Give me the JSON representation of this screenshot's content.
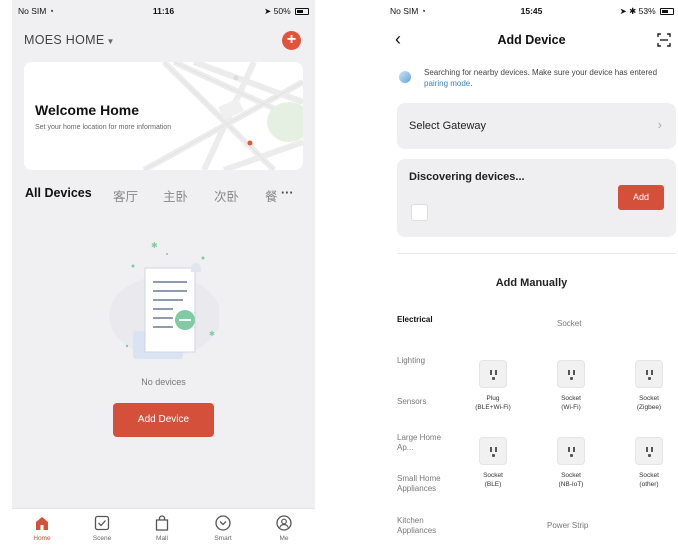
{
  "left": {
    "status": {
      "carrier": "No SIM",
      "time": "11:16",
      "battery": "50%"
    },
    "home_title": "MOES HOME",
    "welcome": {
      "title": "Welcome Home",
      "subtitle": "Set your home location for more information"
    },
    "room_tabs": [
      "All Devices",
      "客厅",
      "主卧",
      "次卧",
      "餐",
      "···"
    ],
    "empty_text": "No devices",
    "add_device_button": "Add Device",
    "tabbar": [
      {
        "label": "Home",
        "icon": "home-icon"
      },
      {
        "label": "Scene",
        "icon": "scene-icon"
      },
      {
        "label": "Mall",
        "icon": "mall-icon"
      },
      {
        "label": "Smart",
        "icon": "smart-icon"
      },
      {
        "label": "Me",
        "icon": "me-icon"
      }
    ],
    "accent_color": "#d4503b"
  },
  "right": {
    "status": {
      "carrier": "No SIM",
      "time": "15:45",
      "battery": "53%"
    },
    "title": "Add Device",
    "searching_text": "Searching for nearby devices. Make sure your device has entered",
    "pairing_link": "pairing mode",
    "searching_end": ".",
    "select_gateway": "Select Gateway",
    "discovering": "Discovering devices...",
    "add_button": "Add",
    "add_manually": "Add Manually",
    "categories": [
      "Electrical",
      "Lighting",
      "Sensors",
      "Large Home Ap...",
      "Small Home Appliances",
      "Kitchen Appliances"
    ],
    "section_socket": "Socket",
    "devices": [
      {
        "name": "Plug",
        "sub": "(BLE+Wi-Fi)"
      },
      {
        "name": "Socket",
        "sub": "(Wi-Fi)"
      },
      {
        "name": "Socket",
        "sub": "(Zigbee)"
      },
      {
        "name": "Socket",
        "sub": "(BLE)"
      },
      {
        "name": "Socket",
        "sub": "(NB-IoT)"
      },
      {
        "name": "Socket",
        "sub": "(other)"
      }
    ],
    "section_power_strip": "Power Strip"
  }
}
